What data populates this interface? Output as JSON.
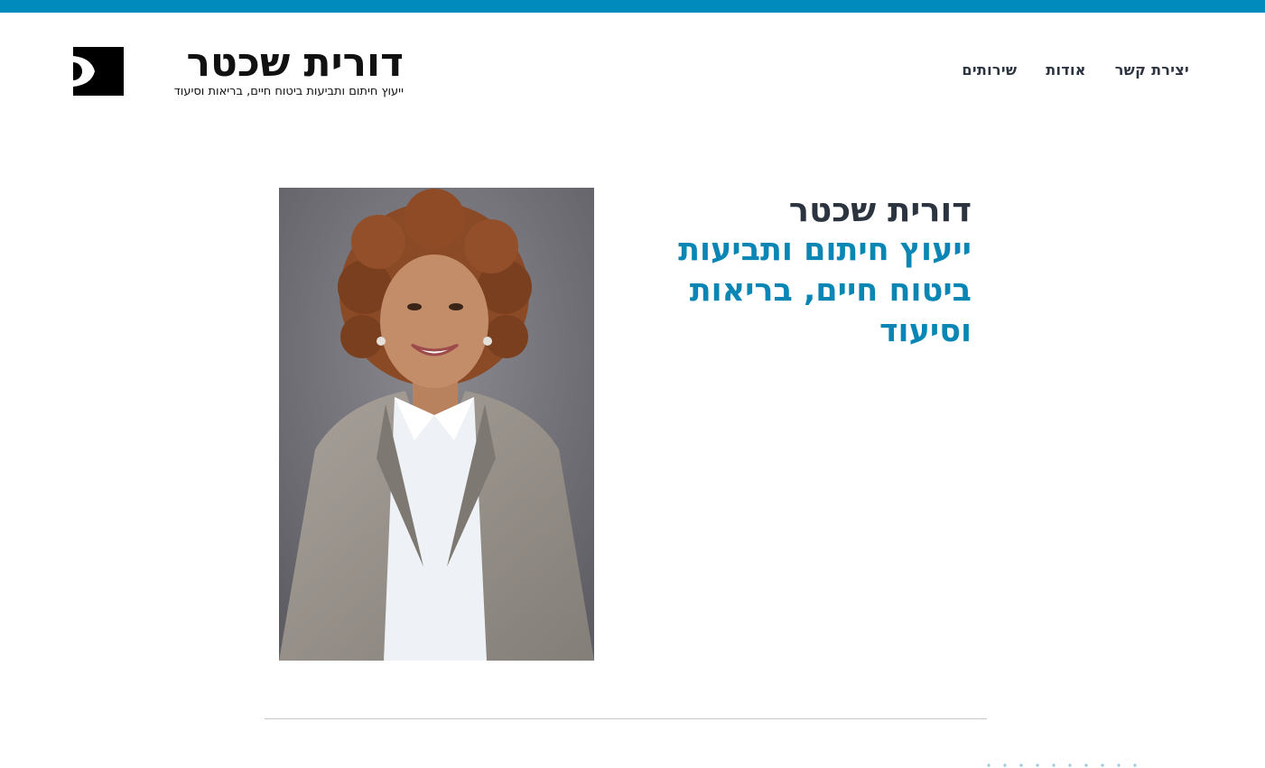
{
  "header": {
    "logo": {
      "name": "דורית שכטר",
      "tagline": "ייעוץ חיתום ותביעות ביטוח חיים, בריאות וסיעוד"
    },
    "nav": {
      "items": [
        {
          "label": "יצירת קשר"
        },
        {
          "label": "אודות"
        },
        {
          "label": "שירותים"
        }
      ]
    }
  },
  "hero": {
    "name": "דורית שכטר",
    "subtitle": "ייעוץ חיתום ותביעות ביטוח חיים, בריאות וסיעוד"
  },
  "colors": {
    "accent": "#008bbd",
    "heading": "#2c3440",
    "subtitle": "#0a86b5"
  }
}
